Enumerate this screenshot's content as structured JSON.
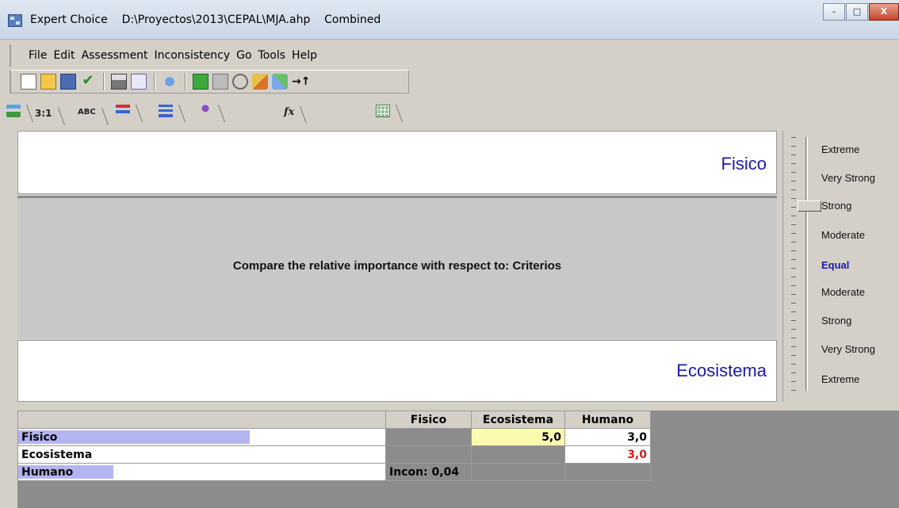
{
  "window": {
    "app_name": "Expert Choice",
    "file_path": "D:\\Proyectos\\2013\\CEPAL\\MJA.ahp",
    "mode": "Combined"
  },
  "menu": [
    "File",
    "Edit",
    "Assessment",
    "Inconsistency",
    "Go",
    "Tools",
    "Help"
  ],
  "tabs": {
    "ratio_label": "3:1",
    "abc_label": "ABC",
    "fx_label": "fx"
  },
  "comparison": {
    "top_element": "Fisico",
    "bottom_element": "Ecosistema",
    "prompt": "Compare the relative importance with respect to: Criterios"
  },
  "scale": {
    "labels": [
      "Extreme",
      "Very Strong",
      "Strong",
      "Moderate",
      "Equal",
      "Moderate",
      "Strong",
      "Very Strong",
      "Extreme"
    ],
    "selected_index": 2,
    "active_label_index": 4
  },
  "matrix": {
    "columns": [
      "Fisico",
      "Ecosistema",
      "Humano"
    ],
    "rows": [
      {
        "name": "Fisico",
        "bar": 0.63,
        "cells": [
          "",
          "5,0",
          "3,0"
        ]
      },
      {
        "name": "Ecosistema",
        "bar": 0.0,
        "cells": [
          "",
          "",
          "3,0"
        ]
      },
      {
        "name": "Humano",
        "bar": 0.26,
        "cells": [
          "Incon: 0,04",
          "",
          ""
        ]
      }
    ]
  },
  "colors": {
    "element_text": "#1a1aa8",
    "highlight_cell": "#fbfbb0",
    "inverse_value": "#cc2222",
    "priority_bar": "#b4b4f0"
  }
}
